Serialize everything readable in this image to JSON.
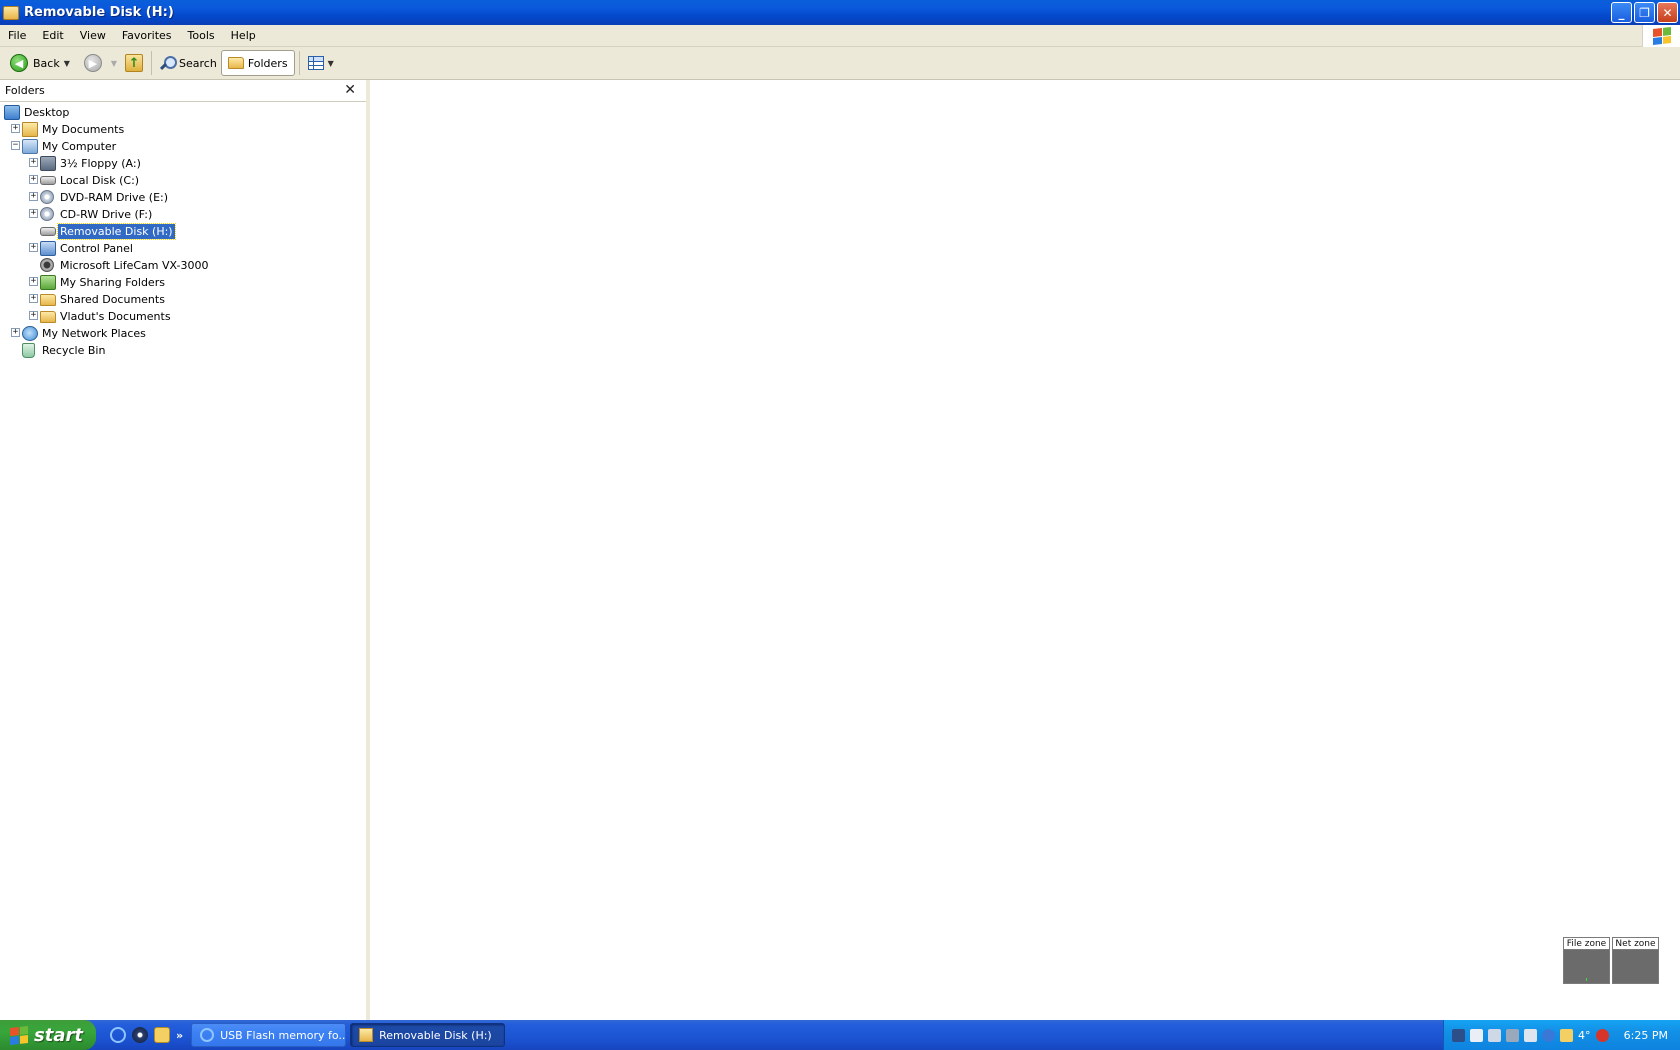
{
  "window": {
    "title": "Removable Disk (H:)",
    "buttons": {
      "minimize": "_",
      "maximize": "❐",
      "close": "✕"
    }
  },
  "menu": [
    "File",
    "Edit",
    "View",
    "Favorites",
    "Tools",
    "Help"
  ],
  "toolbar": {
    "back_label": "Back",
    "search_label": "Search",
    "folders_label": "Folders"
  },
  "folders_pane": {
    "title": "Folders",
    "close_glyph": "✕",
    "tree": [
      {
        "label": "Desktop",
        "icon": "desktop-icon",
        "level": 0,
        "expander": ""
      },
      {
        "label": "My Documents",
        "icon": "my-documents-icon",
        "level": 1,
        "expander": "+"
      },
      {
        "label": "My Computer",
        "icon": "my-computer-icon",
        "level": 1,
        "expander": "−"
      },
      {
        "label": "3½ Floppy (A:)",
        "icon": "floppy-drive-icon",
        "level": 2,
        "expander": "+"
      },
      {
        "label": "Local Disk (C:)",
        "icon": "hard-disk-icon",
        "level": 2,
        "expander": "+"
      },
      {
        "label": "DVD-RAM Drive (E:)",
        "icon": "dvd-drive-icon",
        "level": 2,
        "expander": "+"
      },
      {
        "label": "CD-RW Drive (F:)",
        "icon": "cd-drive-icon",
        "level": 2,
        "expander": "+"
      },
      {
        "label": "Removable Disk (H:)",
        "icon": "removable-disk-icon",
        "level": 2,
        "expander": "",
        "selected": true
      },
      {
        "label": "Control Panel",
        "icon": "control-panel-icon",
        "level": 2,
        "expander": "+"
      },
      {
        "label": "Microsoft LifeCam VX-3000",
        "icon": "webcam-icon",
        "level": 2,
        "expander": ""
      },
      {
        "label": "My Sharing Folders",
        "icon": "sharing-folders-icon",
        "level": 2,
        "expander": "+"
      },
      {
        "label": "Shared Documents",
        "icon": "folder-icon",
        "level": 2,
        "expander": "+"
      },
      {
        "label": "Vladut's Documents",
        "icon": "folder-icon",
        "level": 2,
        "expander": "+"
      },
      {
        "label": "My Network Places",
        "icon": "network-places-icon",
        "level": 1,
        "expander": "+"
      },
      {
        "label": "Recycle Bin",
        "icon": "recycle-bin-icon",
        "level": 1,
        "expander": ""
      }
    ]
  },
  "monitor": {
    "file_zone": "File zone",
    "net_zone": "Net zone"
  },
  "taskbar": {
    "start_label": "start",
    "more_glyph": "»",
    "tasks": [
      {
        "label": "USB Flash memory fo...",
        "icon": "internet-explorer-icon",
        "active": false
      },
      {
        "label": "Removable Disk (H:)",
        "icon": "folder-icon",
        "active": true
      }
    ],
    "tray": {
      "temperature": "4°",
      "clock": "6:25 PM"
    }
  },
  "colors": {
    "titlebar": "#0a5fd8",
    "selection": "#316ac5",
    "chrome": "#ece9d8",
    "start_green": "#37a63b",
    "tray_blue": "#1290e6"
  }
}
